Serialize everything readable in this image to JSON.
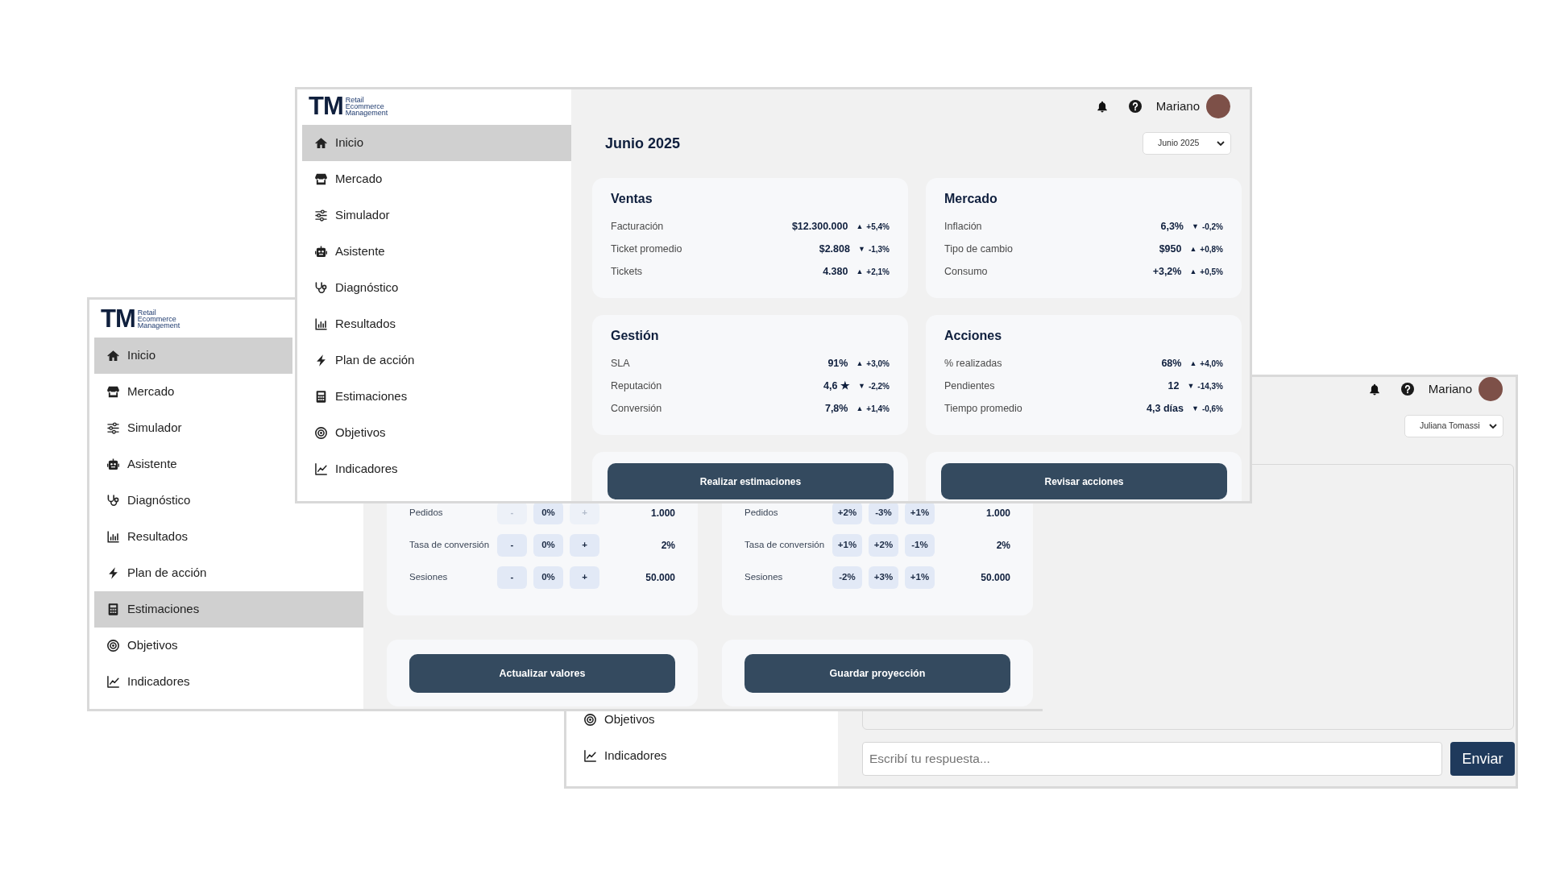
{
  "windows": [
    {
      "kind": "dashboard",
      "logo": {
        "mark": "TM",
        "tagline": "Retail Ecommerce Management"
      },
      "sidebar": {
        "items": [
          {
            "kind": "home",
            "label": "Inicio",
            "selected": true
          },
          {
            "kind": "market",
            "label": "Mercado",
            "selected": false
          },
          {
            "kind": "simulator",
            "label": "Simulador",
            "selected": false
          },
          {
            "kind": "assistant",
            "label": "Asistente",
            "selected": false
          },
          {
            "kind": "diagnosis",
            "label": "Diagnóstico",
            "selected": false
          },
          {
            "kind": "results",
            "label": "Resultados",
            "selected": false
          },
          {
            "kind": "action",
            "label": "Plan de acción",
            "selected": false
          },
          {
            "kind": "estimates",
            "label": "Estimaciones",
            "selected": false
          },
          {
            "kind": "goals",
            "label": "Objetivos",
            "selected": false
          },
          {
            "kind": "indicators",
            "label": "Indicadores",
            "selected": false
          }
        ]
      },
      "header": {
        "user": "Mariano"
      },
      "title": "Junio 2025",
      "period_select": {
        "value": "Junio 2025"
      },
      "cards": [
        {
          "title": "Ventas",
          "rows": [
            {
              "label": "Facturación",
              "value": "$12.300.000",
              "arrow": "▲",
              "change": "+5,4%"
            },
            {
              "label": "Ticket promedio",
              "value": "$2.808",
              "arrow": "▼",
              "change": "-1,3%"
            },
            {
              "label": "Tickets",
              "value": "4.380",
              "arrow": "▲",
              "change": "+2,1%"
            }
          ]
        },
        {
          "title": "Mercado",
          "rows": [
            {
              "label": "Inflación",
              "value": "6,3%",
              "arrow": "▼",
              "change": "-0,2%"
            },
            {
              "label": "Tipo de cambio",
              "value": "$950",
              "arrow": "▲",
              "change": "+0,8%"
            },
            {
              "label": "Consumo",
              "value": "+3,2%",
              "arrow": "▲",
              "change": "+0,5%"
            }
          ]
        },
        {
          "title": "Gestión",
          "rows": [
            {
              "label": "SLA",
              "value": "91%",
              "arrow": "▲",
              "change": "+3,0%"
            },
            {
              "label": "Reputación",
              "value": "4,6 ★",
              "arrow": "▼",
              "change": "-2,2%"
            },
            {
              "label": "Conversión",
              "value": "7,8%",
              "arrow": "▲",
              "change": "+1,4%"
            }
          ]
        },
        {
          "title": "Acciones",
          "rows": [
            {
              "label": "% realizadas",
              "value": "68%",
              "arrow": "▲",
              "change": "+4,0%"
            },
            {
              "label": "Pendientes",
              "value": "12",
              "arrow": "▼",
              "change": "-14,3%"
            },
            {
              "label": "Tiempo promedio",
              "value": "4,3 días",
              "arrow": "▼",
              "change": "-0,6%"
            }
          ]
        }
      ],
      "action_buttons": [
        "Realizar estimaciones",
        "Revisar acciones"
      ]
    },
    {
      "kind": "estimates",
      "logo": {
        "mark": "TM",
        "tagline": "Retail Ecommerce Management"
      },
      "sidebar": {
        "items": [
          {
            "kind": "home",
            "label": "Inicio",
            "selected": true
          },
          {
            "kind": "market",
            "label": "Mercado",
            "selected": false
          },
          {
            "kind": "simulator",
            "label": "Simulador",
            "selected": false
          },
          {
            "kind": "assistant",
            "label": "Asistente",
            "selected": false
          },
          {
            "kind": "diagnosis",
            "label": "Diagnóstico",
            "selected": false
          },
          {
            "kind": "results",
            "label": "Resultados",
            "selected": false
          },
          {
            "kind": "action",
            "label": "Plan de acción",
            "selected": false
          },
          {
            "kind": "estimates",
            "label": "Estimaciones",
            "selected": true
          },
          {
            "kind": "goals",
            "label": "Objetivos",
            "selected": false
          },
          {
            "kind": "indicators",
            "label": "Indicadores",
            "selected": false
          }
        ]
      },
      "panels": [
        {
          "rows": [
            {
              "label": "Pedidos",
              "controls": [
                {
                  "text": "-",
                  "disabled": true
                },
                {
                  "text": "0%",
                  "disabled": false
                },
                {
                  "text": "+",
                  "disabled": true
                }
              ],
              "value": "1.000"
            },
            {
              "label": "Tasa de conversión",
              "controls": [
                {
                  "text": "-",
                  "disabled": false
                },
                {
                  "text": "0%",
                  "disabled": false
                },
                {
                  "text": "+",
                  "disabled": false
                }
              ],
              "value": "2%"
            },
            {
              "label": "Sesiones",
              "controls": [
                {
                  "text": "-",
                  "disabled": false
                },
                {
                  "text": "0%",
                  "disabled": false
                },
                {
                  "text": "+",
                  "disabled": false
                }
              ],
              "value": "50.000"
            }
          ]
        },
        {
          "rows": [
            {
              "label": "Pedidos",
              "controls": [
                {
                  "text": "+2%",
                  "disabled": false
                },
                {
                  "text": "-3%",
                  "disabled": false
                },
                {
                  "text": "+1%",
                  "disabled": false
                }
              ],
              "value": "1.000"
            },
            {
              "label": "Tasa de conversión",
              "controls": [
                {
                  "text": "+1%",
                  "disabled": false
                },
                {
                  "text": "+2%",
                  "disabled": false
                },
                {
                  "text": "-1%",
                  "disabled": false
                }
              ],
              "value": "2%"
            },
            {
              "label": "Sesiones",
              "controls": [
                {
                  "text": "-2%",
                  "disabled": false
                },
                {
                  "text": "+3%",
                  "disabled": false
                },
                {
                  "text": "+1%",
                  "disabled": false
                }
              ],
              "value": "50.000"
            }
          ]
        }
      ],
      "buttons": [
        "Actualizar valores",
        "Guardar proyección"
      ]
    },
    {
      "kind": "chat",
      "sidebar": {
        "items": [
          {
            "kind": "goals",
            "label": "Objetivos",
            "selected": false
          },
          {
            "kind": "indicators",
            "label": "Indicadores",
            "selected": false
          }
        ]
      },
      "header": {
        "user": "Mariano"
      },
      "client_select": {
        "value": "Juliana Tomassi"
      },
      "message_input": {
        "placeholder": "Escribí tu respuesta..."
      },
      "send_button": "Enviar"
    }
  ]
}
